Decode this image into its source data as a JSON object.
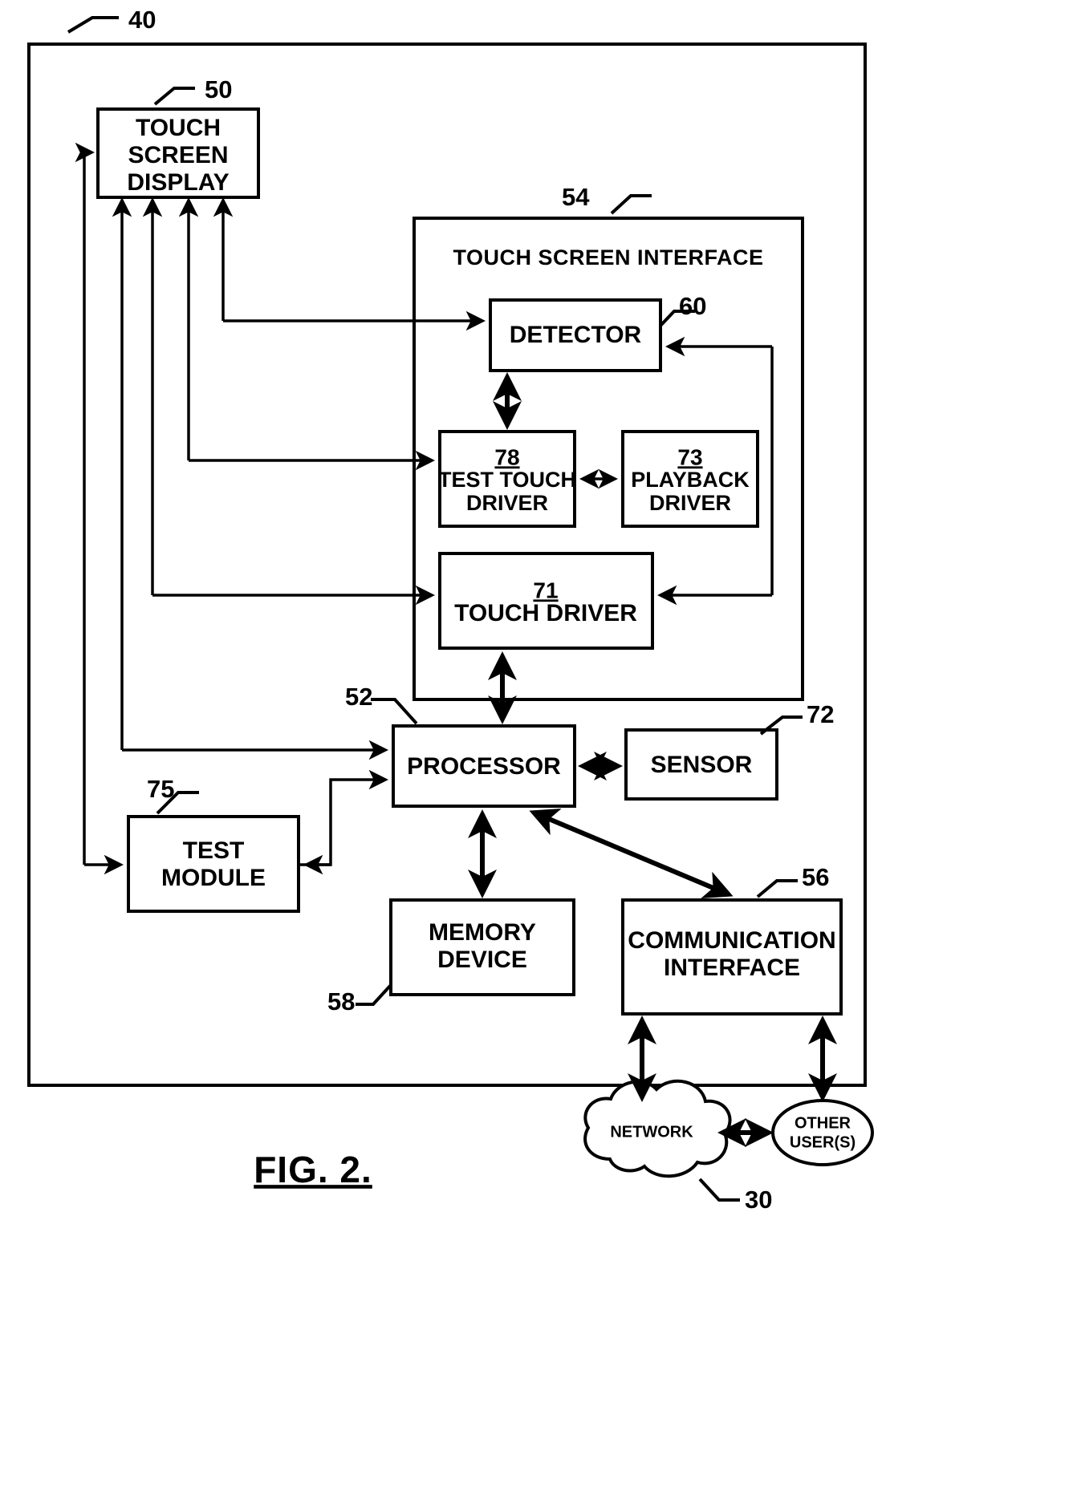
{
  "figure": {
    "caption": "FIG. 2.",
    "outer_ref": "40"
  },
  "refs": {
    "outer_system": "40",
    "touch_screen_display": "50",
    "touch_screen_interface": "54",
    "detector": "60",
    "test_touch_driver": "78",
    "playback_driver": "73",
    "touch_driver": "71",
    "processor": "52",
    "sensor": "72",
    "test_module": "75",
    "memory_device": "58",
    "communication_interface": "56",
    "network": "30"
  },
  "blocks": {
    "touch_screen_display": {
      "line1": "TOUCH",
      "line2": "SCREEN",
      "line3": "DISPLAY"
    },
    "touch_screen_interface": {
      "title": "TOUCH SCREEN INTERFACE"
    },
    "detector": {
      "label": "DETECTOR"
    },
    "test_touch_driver": {
      "refnum": "78",
      "line1": "TEST TOUCH",
      "line2": "DRIVER"
    },
    "playback_driver": {
      "refnum": "73",
      "line1": "PLAYBACK",
      "line2": "DRIVER"
    },
    "touch_driver": {
      "refnum": "71",
      "line1": "TOUCH DRIVER"
    },
    "processor": {
      "label": "PROCESSOR"
    },
    "sensor": {
      "label": "SENSOR"
    },
    "test_module": {
      "line1": "TEST",
      "line2": "MODULE"
    },
    "memory_device": {
      "line1": "MEMORY",
      "line2": "DEVICE"
    },
    "communication_interface": {
      "line1": "COMMUNICATION",
      "line2": "INTERFACE"
    },
    "network": {
      "label": "NETWORK"
    },
    "other_users": {
      "line1": "OTHER",
      "line2": "USER(S)"
    }
  },
  "colors": {
    "ink": "#000000",
    "paper": "#ffffff"
  }
}
